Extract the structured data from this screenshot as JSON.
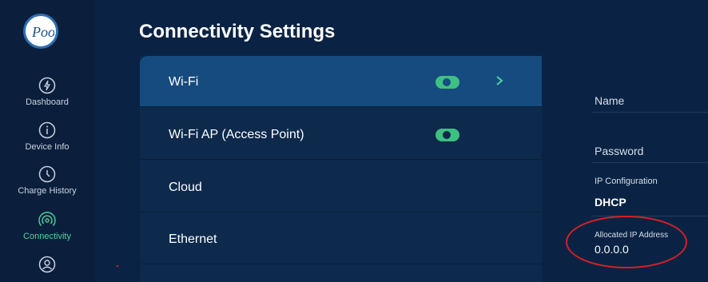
{
  "app": {
    "logo_text": "Poo",
    "accent_color": "#4fd39a",
    "selected_row_color": "#164b7f"
  },
  "sidebar": {
    "items": [
      {
        "label": "Dashboard",
        "icon": "bolt-icon",
        "active": false
      },
      {
        "label": "Device Info",
        "icon": "info-icon",
        "active": false
      },
      {
        "label": "Charge History",
        "icon": "clock-icon",
        "active": false
      },
      {
        "label": "Connectivity",
        "icon": "signal-icon",
        "active": true
      },
      {
        "label": "",
        "icon": "user-icon",
        "active": false
      }
    ]
  },
  "page": {
    "title": "Connectivity Settings"
  },
  "connections": [
    {
      "label": "Wi-Fi",
      "toggle": true,
      "selected": true
    },
    {
      "label": "Wi-Fi AP (Access Point)",
      "toggle": true,
      "selected": false
    },
    {
      "label": "Cloud",
      "toggle": false,
      "selected": false
    },
    {
      "label": "Ethernet",
      "toggle": false,
      "selected": false
    }
  ],
  "details": {
    "name_label": "Name",
    "password_label": "Password",
    "ip_config_label": "IP Configuration",
    "ip_config_value": "DHCP",
    "allocated_ip_label": "Allocated IP Address",
    "allocated_ip_value": "0.0.0.0"
  }
}
